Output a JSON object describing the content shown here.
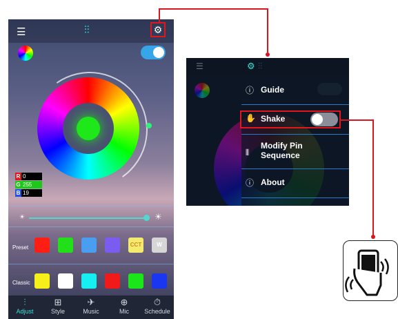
{
  "phone": {
    "rgb": [
      {
        "ch": "R",
        "value": "0",
        "color": "#e3161b"
      },
      {
        "ch": "G",
        "value": "255",
        "color": "#1ec81a"
      },
      {
        "ch": "B",
        "value": "19",
        "color": "#1f4ff0"
      }
    ],
    "preset_label": "Preset",
    "classic_label": "Classic",
    "preset_swatches": [
      {
        "color": "#ff1e14",
        "text": ""
      },
      {
        "color": "#21e01a",
        "text": ""
      },
      {
        "color": "#4a9ef0",
        "text": ""
      },
      {
        "color": "#7a5cf0",
        "text": ""
      },
      {
        "color": "#f4ea70",
        "text": "CCT"
      },
      {
        "color": "#d6d6d6",
        "text": "W"
      }
    ],
    "classic_swatches": [
      {
        "color": "#f5f01a",
        "text": ""
      },
      {
        "color": "#ffffff",
        "text": ""
      },
      {
        "color": "#17eef2",
        "text": ""
      },
      {
        "color": "#f01a1a",
        "text": ""
      },
      {
        "color": "#1ae61a",
        "text": ""
      },
      {
        "color": "#1a36f0",
        "text": ""
      }
    ],
    "tabs": [
      {
        "label": "Adjust",
        "icon": "sliders-icon",
        "glyph": "⫶",
        "active": true
      },
      {
        "label": "Style",
        "icon": "grid-icon",
        "glyph": "⊞",
        "active": false
      },
      {
        "label": "Music",
        "icon": "music-icon",
        "glyph": "✈",
        "active": false
      },
      {
        "label": "Mic",
        "icon": "microphone-icon",
        "glyph": "⊕",
        "active": false
      },
      {
        "label": "Schedule",
        "icon": "stopwatch-icon",
        "glyph": "⏱",
        "active": false
      }
    ]
  },
  "menu": {
    "items": [
      {
        "label": "Guide",
        "icon": "help-circle-icon",
        "glyph": "?"
      },
      {
        "label": "Shake",
        "icon": "shake-icon",
        "glyph": "✋"
      },
      {
        "label": "Modify Pin\nSequence",
        "line1": "Modify Pin",
        "line2": "Sequence",
        "icon": "pin-sequence-icon",
        "glyph": "⫴"
      },
      {
        "label": "About",
        "icon": "info-icon",
        "glyph": "ⓘ"
      }
    ]
  },
  "colors": {
    "accent": "#35e0d3",
    "highlight": "#e3161b",
    "toggle_on": "#36a6e8"
  }
}
